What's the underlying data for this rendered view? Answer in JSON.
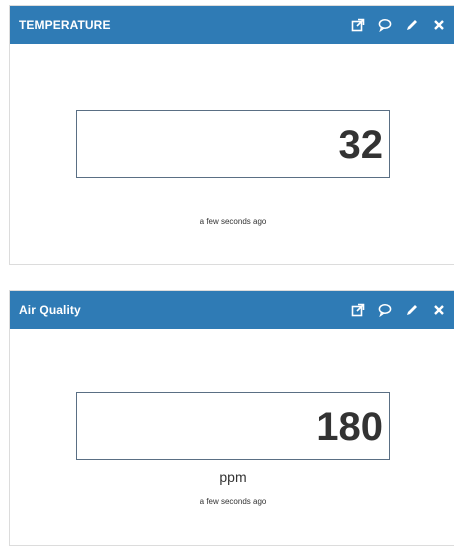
{
  "widgets": [
    {
      "title": "TEMPERATURE",
      "value": "32",
      "unit": "",
      "updated": "a few seconds ago"
    },
    {
      "title": "Air Quality",
      "value": "180",
      "unit": "ppm",
      "updated": "a few seconds ago"
    }
  ],
  "header_icons": [
    "external-link-icon",
    "comment-icon",
    "pencil-icon",
    "close-icon"
  ],
  "colors": {
    "header_bg": "#2f7bb5",
    "header_text": "#ffffff",
    "value_text": "#333333",
    "box_border": "#5a6f84"
  }
}
